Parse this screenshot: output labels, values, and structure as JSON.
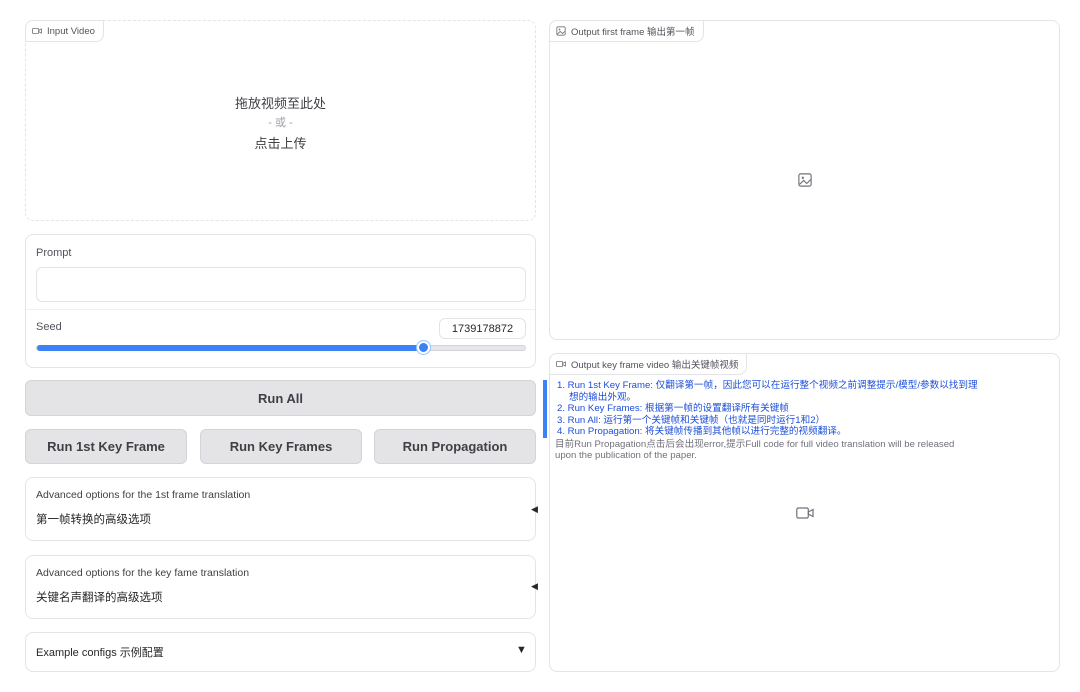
{
  "input_video": {
    "label": "Input Video",
    "drop_text": "拖放视频至此处",
    "or_text": "- 或 -",
    "click_text": "点击上传"
  },
  "prompt": {
    "label": "Prompt",
    "value": "",
    "placeholder": ""
  },
  "seed": {
    "label": "Seed",
    "value": "1739178872",
    "slider_fraction": 0.79
  },
  "buttons": {
    "run_all": "Run All",
    "run_first": "Run 1st Key Frame",
    "run_key_frames": "Run Key Frames",
    "run_propagation": "Run Propagation"
  },
  "accordions": [
    {
      "title": "Advanced options for the 1st frame translation",
      "subtitle": "第一帧转换的高级选项",
      "arrow": "◀"
    },
    {
      "title": "Advanced options for the key fame translation",
      "subtitle": "关键名声翻译的高级选项",
      "arrow": "◀"
    },
    {
      "title": "Example configs 示例配置",
      "arrow": "▼"
    }
  ],
  "output_first_frame": {
    "label": "Output first frame 输出第一帧",
    "icon": "image-icon"
  },
  "output_key_video": {
    "label": "Output key frame video 输出关键帧视频",
    "icon": "video-icon"
  },
  "instructions": {
    "items": [
      "1. Run 1st Key Frame: 仅翻译第一帧，因此您可以在运行整个视频之前调整提示/模型/参数以找到理",
      "    想的输出外观。",
      "2. Run Key Frames: 根据第一帧的设置翻译所有关键帧",
      "3. Run All: 运行第一个关键帧和关键帧（也就是同时运行1和2）",
      "4. Run Propagation: 将关键帧传播到其他帧以进行完整的视频翻译。"
    ],
    "note_line1": "目前Run Propagation点击后会出现error,提示Full code for full video translation will be released",
    "note_line2": "upon the publication of the paper."
  },
  "colors": {
    "accent": "#3b82f6",
    "link_text": "#1d4ed8",
    "button_bg": "#e4e4e7"
  }
}
